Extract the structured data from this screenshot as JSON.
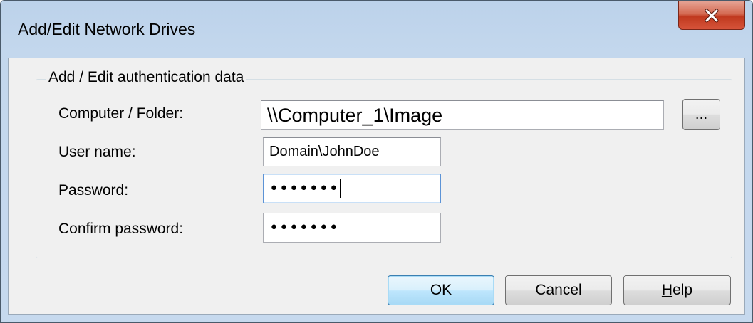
{
  "window": {
    "title": "Add/Edit Network Drives",
    "close_glyph": "close-icon"
  },
  "group": {
    "label": "Add / Edit authentication data"
  },
  "fields": {
    "computer_folder": {
      "label": "Computer / Folder:",
      "value": "\\\\Computer_1\\Image"
    },
    "user_name": {
      "label": "User name:",
      "value": "Domain\\JohnDoe"
    },
    "password": {
      "label": "Password:",
      "value": "•••••••"
    },
    "confirm_password": {
      "label": "Confirm password:",
      "value": "•••••••"
    }
  },
  "browse_button": {
    "label": "..."
  },
  "buttons": {
    "ok": "OK",
    "cancel": "Cancel",
    "help_first": "H",
    "help_rest": "elp"
  },
  "colors": {
    "close_button": "#c7432a",
    "default_button_border": "#3c7fb1",
    "focus_border": "#5c93d6"
  }
}
